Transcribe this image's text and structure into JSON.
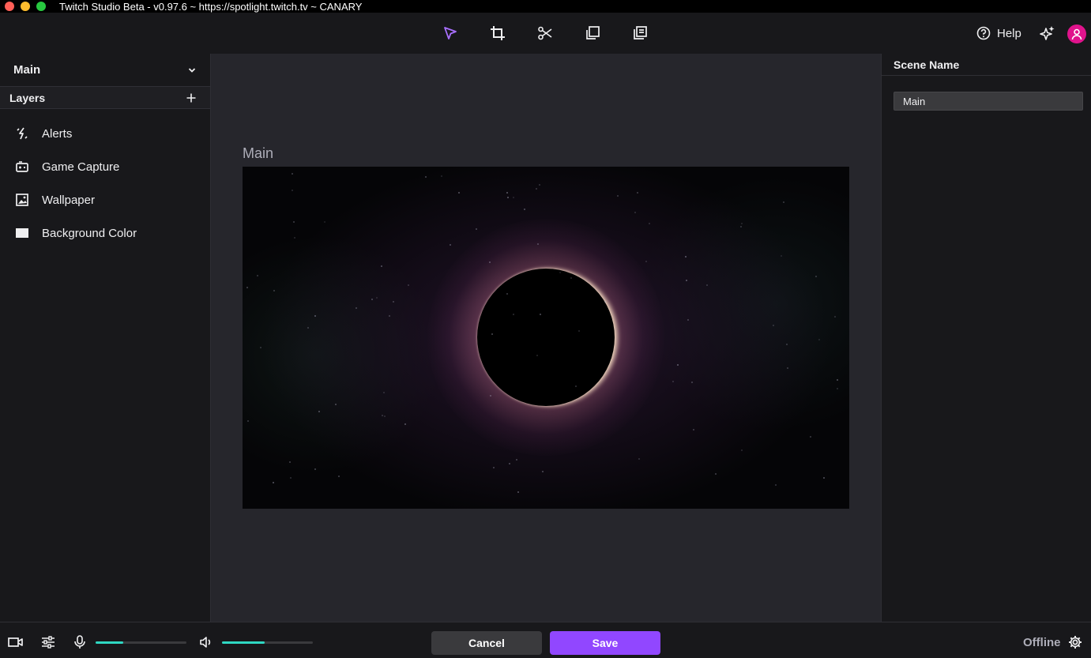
{
  "window": {
    "title": "Twitch Studio Beta - v0.97.6 ~ https://spotlight.twitch.tv ~ CANARY"
  },
  "toolbar": {
    "tools": [
      {
        "name": "select-tool",
        "icon": "cursor-arrow-icon",
        "active": true
      },
      {
        "name": "crop-tool",
        "icon": "crop-icon"
      },
      {
        "name": "cut-tool",
        "icon": "scissors-icon"
      },
      {
        "name": "duplicate-tool",
        "icon": "copy-icon"
      },
      {
        "name": "layers-tool",
        "icon": "stack-icon"
      }
    ],
    "help_label": "Help",
    "active_color": "#a970ff"
  },
  "left_panel": {
    "scene_name": "Main",
    "layers_title": "Layers",
    "layers": [
      {
        "label": "Alerts",
        "icon": "alert-bolt-icon"
      },
      {
        "label": "Game Capture",
        "icon": "gamepad-icon"
      },
      {
        "label": "Wallpaper",
        "icon": "image-icon"
      },
      {
        "label": "Background Color",
        "icon": "color-rect-icon"
      }
    ]
  },
  "canvas": {
    "title": "Main"
  },
  "right_panel": {
    "header": "Scene Name",
    "scene_name_value": "Main"
  },
  "bottom_bar": {
    "mic_level": 0.3,
    "speaker_level": 0.47,
    "cancel_label": "Cancel",
    "save_label": "Save",
    "status": "Offline",
    "accent": "#9147ff",
    "level_color": "#2fd8c3"
  }
}
